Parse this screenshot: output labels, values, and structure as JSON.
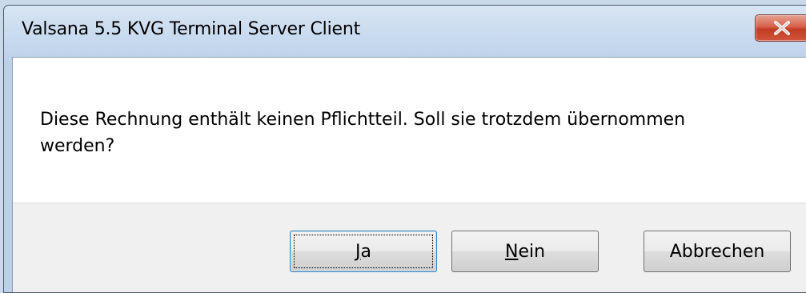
{
  "window": {
    "title": "Valsana 5.5 KVG Terminal Server Client"
  },
  "message": {
    "text": "Diese Rechnung enthält keinen Pflichtteil. Soll sie trotzdem übernommen werden?"
  },
  "buttons": {
    "yes": {
      "mnemonic": "J",
      "rest": "a"
    },
    "no": {
      "mnemonic": "N",
      "rest": "ein"
    },
    "cancel": {
      "label": "Abbrechen"
    }
  },
  "icons": {
    "close": "close-icon"
  },
  "colors": {
    "close_button": "#c9452b",
    "button_area": "#f0f0f0",
    "default_button_border": "#3c7fb1"
  }
}
